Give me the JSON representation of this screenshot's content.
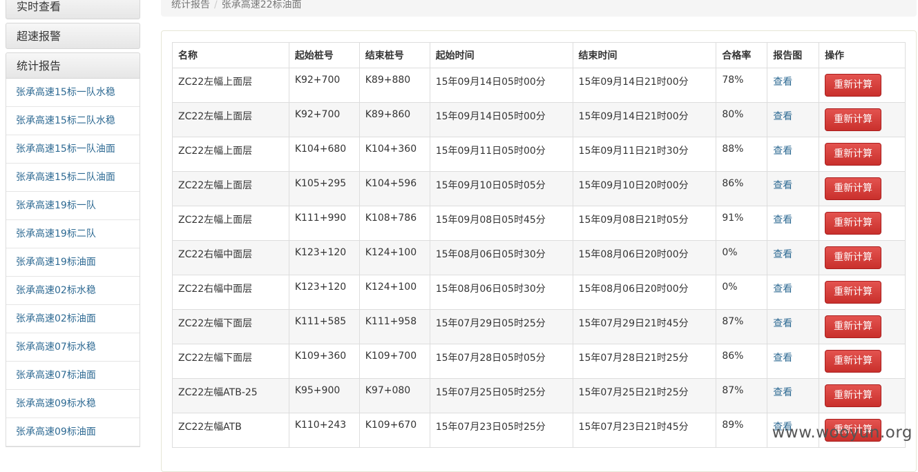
{
  "sidebar": {
    "menus": [
      "实时查看",
      "超速报警",
      "统计报告"
    ],
    "items": [
      "张承高速15标一队水稳",
      "张承高速15标二队水稳",
      "张承高速15标一队油面",
      "张承高速15标二队油面",
      "张承高速19标一队",
      "张承高速19标二队",
      "张承高速19标油面",
      "张承高速02标水稳",
      "张承高速02标油面",
      "张承高速07标水稳",
      "张承高速07标油面",
      "张承高速09标水稳",
      "张承高速09标油面"
    ]
  },
  "breadcrumb": {
    "root": "统计报告",
    "current": "张承高速22标油面"
  },
  "table": {
    "headers": [
      "名称",
      "起始桩号",
      "结束桩号",
      "起始时间",
      "结束时间",
      "合格率",
      "报告图",
      "操作"
    ],
    "view_label": "查看",
    "recalc_label": "重新计算",
    "rows": [
      [
        "ZC22左幅上面层",
        "K92+700",
        "K89+880",
        "15年09月14日05时00分",
        "15年09月14日21时00分",
        "78%"
      ],
      [
        "ZC22左幅上面层",
        "K92+700",
        "K89+860",
        "15年09月14日05时00分",
        "15年09月14日21时00分",
        "80%"
      ],
      [
        "ZC22左幅上面层",
        "K104+680",
        "K104+360",
        "15年09月11日05时00分",
        "15年09月11日21时30分",
        "88%"
      ],
      [
        "ZC22左幅上面层",
        "K105+295",
        "K104+596",
        "15年09月10日05时05分",
        "15年09月10日20时00分",
        "86%"
      ],
      [
        "ZC22左幅上面层",
        "K111+990",
        "K108+786",
        "15年09月08日05时45分",
        "15年09月08日21时05分",
        "91%"
      ],
      [
        "ZC22右幅中面层",
        "K123+120",
        "K124+100",
        "15年08月06日05时30分",
        "15年08月06日20时00分",
        "0%"
      ],
      [
        "ZC22右幅中面层",
        "K123+120",
        "K124+100",
        "15年08月06日05时30分",
        "15年08月06日20时00分",
        "0%"
      ],
      [
        "ZC22左幅下面层",
        "K111+585",
        "K111+958",
        "15年07月29日05时25分",
        "15年07月29日21时45分",
        "87%"
      ],
      [
        "ZC22左幅下面层",
        "K109+360",
        "K109+700",
        "15年07月28日05时05分",
        "15年07月28日21时25分",
        "86%"
      ],
      [
        "ZC22左幅ATB-25",
        "K95+900",
        "K97+080",
        "15年07月25日05时25分",
        "15年07月25日21时25分",
        "87%"
      ],
      [
        "ZC22左幅ATB",
        "K110+243",
        "K109+670",
        "15年07月23日05时25分",
        "15年07月23日21时45分",
        "89%"
      ]
    ]
  },
  "watermark": "www.wooyun.org"
}
